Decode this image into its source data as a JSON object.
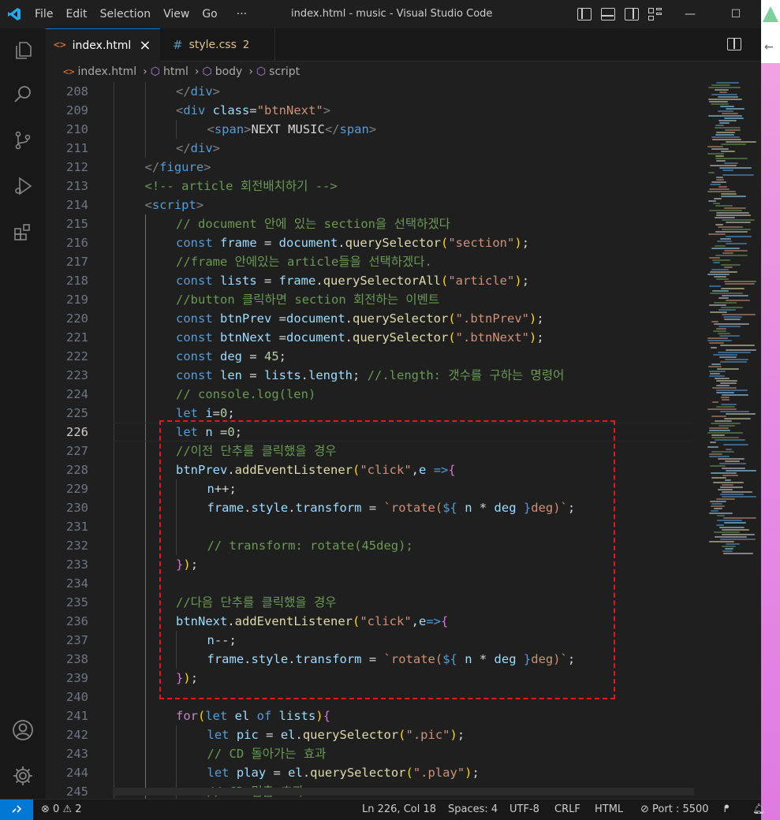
{
  "menu": [
    "File",
    "Edit",
    "Selection",
    "View",
    "Go",
    "···"
  ],
  "window_title": "index.html - music - Visual Studio Code",
  "tabs": [
    {
      "label": "index.html",
      "close": "×"
    },
    {
      "label": "style.css",
      "badge": "2"
    }
  ],
  "breadcrumb": [
    "index.html",
    "html",
    "body",
    "script"
  ],
  "cursor_line": 226,
  "code_lines": [
    {
      "n": 208,
      "indent": 2,
      "tokens": [
        [
          "tg",
          "</"
        ],
        [
          "t",
          "div"
        ],
        [
          "tg",
          ">"
        ]
      ]
    },
    {
      "n": 209,
      "indent": 2,
      "tokens": [
        [
          "tg",
          "<"
        ],
        [
          "t",
          "div "
        ],
        [
          "a",
          "class"
        ],
        [
          "w",
          "="
        ],
        [
          "s",
          "\"btnNext\""
        ],
        [
          "tg",
          ">"
        ]
      ]
    },
    {
      "n": 210,
      "indent": 3,
      "tokens": [
        [
          "tg",
          "<"
        ],
        [
          "t",
          "span"
        ],
        [
          "tg",
          ">"
        ],
        [
          "w",
          "NEXT MUSIC"
        ],
        [
          "tg",
          "</"
        ],
        [
          "t",
          "span"
        ],
        [
          "tg",
          ">"
        ]
      ]
    },
    {
      "n": 211,
      "indent": 2,
      "tokens": [
        [
          "tg",
          "</"
        ],
        [
          "t",
          "div"
        ],
        [
          "tg",
          ">"
        ]
      ]
    },
    {
      "n": 212,
      "indent": 1,
      "tokens": [
        [
          "tg",
          "</"
        ],
        [
          "t",
          "figure"
        ],
        [
          "tg",
          ">"
        ]
      ]
    },
    {
      "n": 213,
      "indent": 1,
      "tokens": [
        [
          "cm",
          "<!-- article 회전배치하기 -->"
        ]
      ]
    },
    {
      "n": 214,
      "indent": 1,
      "tokens": [
        [
          "tg",
          "<"
        ],
        [
          "t",
          "script"
        ],
        [
          "tg",
          ">"
        ]
      ]
    },
    {
      "n": 215,
      "indent": 2,
      "tokens": [
        [
          "cm",
          "// document 안에 있는 section을 선택하겠다"
        ]
      ]
    },
    {
      "n": 216,
      "indent": 2,
      "tokens": [
        [
          "k",
          "const "
        ],
        [
          "v",
          "frame"
        ],
        [
          "w",
          " = "
        ],
        [
          "v",
          "document"
        ],
        [
          "w",
          "."
        ],
        [
          "f",
          "querySelector"
        ],
        [
          "y",
          "("
        ],
        [
          "s",
          "\"section\""
        ],
        [
          "y",
          ")"
        ],
        [
          "w",
          ";"
        ]
      ]
    },
    {
      "n": 217,
      "indent": 2,
      "tokens": [
        [
          "cm",
          "//frame 안에있는 article들을 선택하겠다."
        ]
      ]
    },
    {
      "n": 218,
      "indent": 2,
      "tokens": [
        [
          "k",
          "const "
        ],
        [
          "v",
          "lists"
        ],
        [
          "w",
          " = "
        ],
        [
          "v",
          "frame"
        ],
        [
          "w",
          "."
        ],
        [
          "f",
          "querySelectorAll"
        ],
        [
          "y",
          "("
        ],
        [
          "s",
          "\"article\""
        ],
        [
          "y",
          ")"
        ],
        [
          "w",
          ";"
        ]
      ]
    },
    {
      "n": 219,
      "indent": 2,
      "tokens": [
        [
          "cm",
          "//button 클릭하면 section 회전하는 이벤트"
        ]
      ]
    },
    {
      "n": 220,
      "indent": 2,
      "tokens": [
        [
          "k",
          "const "
        ],
        [
          "v",
          "btnPrev"
        ],
        [
          "w",
          " ="
        ],
        [
          "v",
          "document"
        ],
        [
          "w",
          "."
        ],
        [
          "f",
          "querySelector"
        ],
        [
          "y",
          "("
        ],
        [
          "s",
          "\".btnPrev\""
        ],
        [
          "y",
          ")"
        ],
        [
          "w",
          ";"
        ]
      ]
    },
    {
      "n": 221,
      "indent": 2,
      "tokens": [
        [
          "k",
          "const "
        ],
        [
          "v",
          "btnNext"
        ],
        [
          "w",
          " ="
        ],
        [
          "v",
          "document"
        ],
        [
          "w",
          "."
        ],
        [
          "f",
          "querySelector"
        ],
        [
          "y",
          "("
        ],
        [
          "s",
          "\".btnNext\""
        ],
        [
          "y",
          ")"
        ],
        [
          "w",
          ";"
        ]
      ]
    },
    {
      "n": 222,
      "indent": 2,
      "tokens": [
        [
          "k",
          "const "
        ],
        [
          "v",
          "deg"
        ],
        [
          "w",
          " = "
        ],
        [
          "n",
          "45"
        ],
        [
          "w",
          ";"
        ]
      ]
    },
    {
      "n": 223,
      "indent": 2,
      "tokens": [
        [
          "k",
          "const "
        ],
        [
          "v",
          "len"
        ],
        [
          "w",
          " = "
        ],
        [
          "v",
          "lists"
        ],
        [
          "w",
          "."
        ],
        [
          "v",
          "length"
        ],
        [
          "w",
          "; "
        ],
        [
          "cm",
          "//.length: 갯수를 구하는 명령어"
        ]
      ]
    },
    {
      "n": 224,
      "indent": 2,
      "tokens": [
        [
          "cm",
          "// console.log(len)"
        ]
      ]
    },
    {
      "n": 225,
      "indent": 2,
      "tokens": [
        [
          "k",
          "let "
        ],
        [
          "v",
          "i"
        ],
        [
          "w",
          "="
        ],
        [
          "n",
          "0"
        ],
        [
          "w",
          ";"
        ]
      ]
    },
    {
      "n": 226,
      "indent": 2,
      "tokens": [
        [
          "k",
          "let "
        ],
        [
          "v",
          "n"
        ],
        [
          "w",
          " ="
        ],
        [
          "n",
          "0"
        ],
        [
          "w",
          ";"
        ]
      ]
    },
    {
      "n": 227,
      "indent": 2,
      "tokens": [
        [
          "cm",
          "//이전 단추를 클릭했을 경우"
        ]
      ]
    },
    {
      "n": 228,
      "indent": 2,
      "tokens": [
        [
          "v",
          "btnPrev"
        ],
        [
          "w",
          "."
        ],
        [
          "f",
          "addEventListener"
        ],
        [
          "y",
          "("
        ],
        [
          "s",
          "\"click\""
        ],
        [
          "w",
          ","
        ],
        [
          "v",
          "e"
        ],
        [
          "w",
          " "
        ],
        [
          "k",
          "=>"
        ],
        [
          "p",
          "{"
        ]
      ]
    },
    {
      "n": 229,
      "indent": 3,
      "tokens": [
        [
          "v",
          "n"
        ],
        [
          "w",
          "++;"
        ]
      ]
    },
    {
      "n": 230,
      "indent": 3,
      "tokens": [
        [
          "v",
          "frame"
        ],
        [
          "w",
          "."
        ],
        [
          "v",
          "style"
        ],
        [
          "w",
          "."
        ],
        [
          "v",
          "transform"
        ],
        [
          "w",
          " = "
        ],
        [
          "s",
          "`rotate("
        ],
        [
          "k",
          "${"
        ],
        [
          "w",
          " "
        ],
        [
          "v",
          "n"
        ],
        [
          "w",
          " * "
        ],
        [
          "v",
          "deg"
        ],
        [
          "w",
          " "
        ],
        [
          "k",
          "}"
        ],
        [
          "s",
          "deg)`"
        ],
        [
          "w",
          ";"
        ]
      ]
    },
    {
      "n": 231,
      "indent": 3,
      "tokens": []
    },
    {
      "n": 232,
      "indent": 3,
      "tokens": [
        [
          "cm",
          "// transform: rotate(45deg);"
        ]
      ]
    },
    {
      "n": 233,
      "indent": 2,
      "tokens": [
        [
          "p",
          "}"
        ],
        [
          "y",
          ")"
        ],
        [
          "w",
          ";"
        ]
      ]
    },
    {
      "n": 234,
      "indent": 2,
      "tokens": []
    },
    {
      "n": 235,
      "indent": 2,
      "tokens": [
        [
          "cm",
          "//다음 단추를 클릭했을 경우"
        ]
      ]
    },
    {
      "n": 236,
      "indent": 2,
      "tokens": [
        [
          "v",
          "btnNext"
        ],
        [
          "w",
          "."
        ],
        [
          "f",
          "addEventListener"
        ],
        [
          "y",
          "("
        ],
        [
          "s",
          "\"click\""
        ],
        [
          "w",
          ","
        ],
        [
          "v",
          "e"
        ],
        [
          "k",
          "=>"
        ],
        [
          "p",
          "{"
        ]
      ]
    },
    {
      "n": 237,
      "indent": 3,
      "tokens": [
        [
          "v",
          "n"
        ],
        [
          "w",
          "--;"
        ]
      ]
    },
    {
      "n": 238,
      "indent": 3,
      "tokens": [
        [
          "v",
          "frame"
        ],
        [
          "w",
          "."
        ],
        [
          "v",
          "style"
        ],
        [
          "w",
          "."
        ],
        [
          "v",
          "transform"
        ],
        [
          "w",
          " = "
        ],
        [
          "s",
          "`rotate("
        ],
        [
          "k",
          "${"
        ],
        [
          "w",
          " "
        ],
        [
          "v",
          "n"
        ],
        [
          "w",
          " * "
        ],
        [
          "v",
          "deg"
        ],
        [
          "w",
          " "
        ],
        [
          "k",
          "}"
        ],
        [
          "s",
          "deg)`"
        ],
        [
          "w",
          ";"
        ]
      ]
    },
    {
      "n": 239,
      "indent": 2,
      "tokens": [
        [
          "p",
          "}"
        ],
        [
          "y",
          ")"
        ],
        [
          "w",
          ";"
        ]
      ]
    },
    {
      "n": 240,
      "indent": 2,
      "tokens": []
    },
    {
      "n": 241,
      "indent": 2,
      "tokens": [
        [
          "c",
          "for"
        ],
        [
          "y",
          "("
        ],
        [
          "k",
          "let "
        ],
        [
          "v",
          "el"
        ],
        [
          "k",
          " of "
        ],
        [
          "v",
          "lists"
        ],
        [
          "y",
          ")"
        ],
        [
          "p",
          "{"
        ]
      ]
    },
    {
      "n": 242,
      "indent": 3,
      "tokens": [
        [
          "k",
          "let "
        ],
        [
          "v",
          "pic"
        ],
        [
          "w",
          " = "
        ],
        [
          "v",
          "el"
        ],
        [
          "w",
          "."
        ],
        [
          "f",
          "querySelector"
        ],
        [
          "y",
          "("
        ],
        [
          "s",
          "\".pic\""
        ],
        [
          "y",
          ")"
        ],
        [
          "w",
          ";"
        ]
      ]
    },
    {
      "n": 243,
      "indent": 3,
      "tokens": [
        [
          "cm",
          "// CD 돌아가는 효과"
        ]
      ]
    },
    {
      "n": 244,
      "indent": 3,
      "tokens": [
        [
          "k",
          "let "
        ],
        [
          "v",
          "play"
        ],
        [
          "w",
          " = "
        ],
        [
          "v",
          "el"
        ],
        [
          "w",
          "."
        ],
        [
          "f",
          "querySelector"
        ],
        [
          "y",
          "("
        ],
        [
          "s",
          "\".play\""
        ],
        [
          "y",
          ")"
        ],
        [
          "w",
          ";"
        ]
      ]
    },
    {
      "n": 245,
      "indent": 3,
      "tokens": [
        [
          "cm",
          "// CD 멈춤 효과"
        ]
      ]
    }
  ],
  "status": {
    "errors": "0",
    "warnings": "2",
    "position": "Ln 226, Col 18",
    "spaces": "Spaces: 4",
    "encoding": "UTF-8",
    "eol": "CRLF",
    "language": "HTML",
    "port": "Port : 5500"
  },
  "colors": {
    "accent": "#0078d4",
    "highlight_box": "#e31a1a"
  }
}
